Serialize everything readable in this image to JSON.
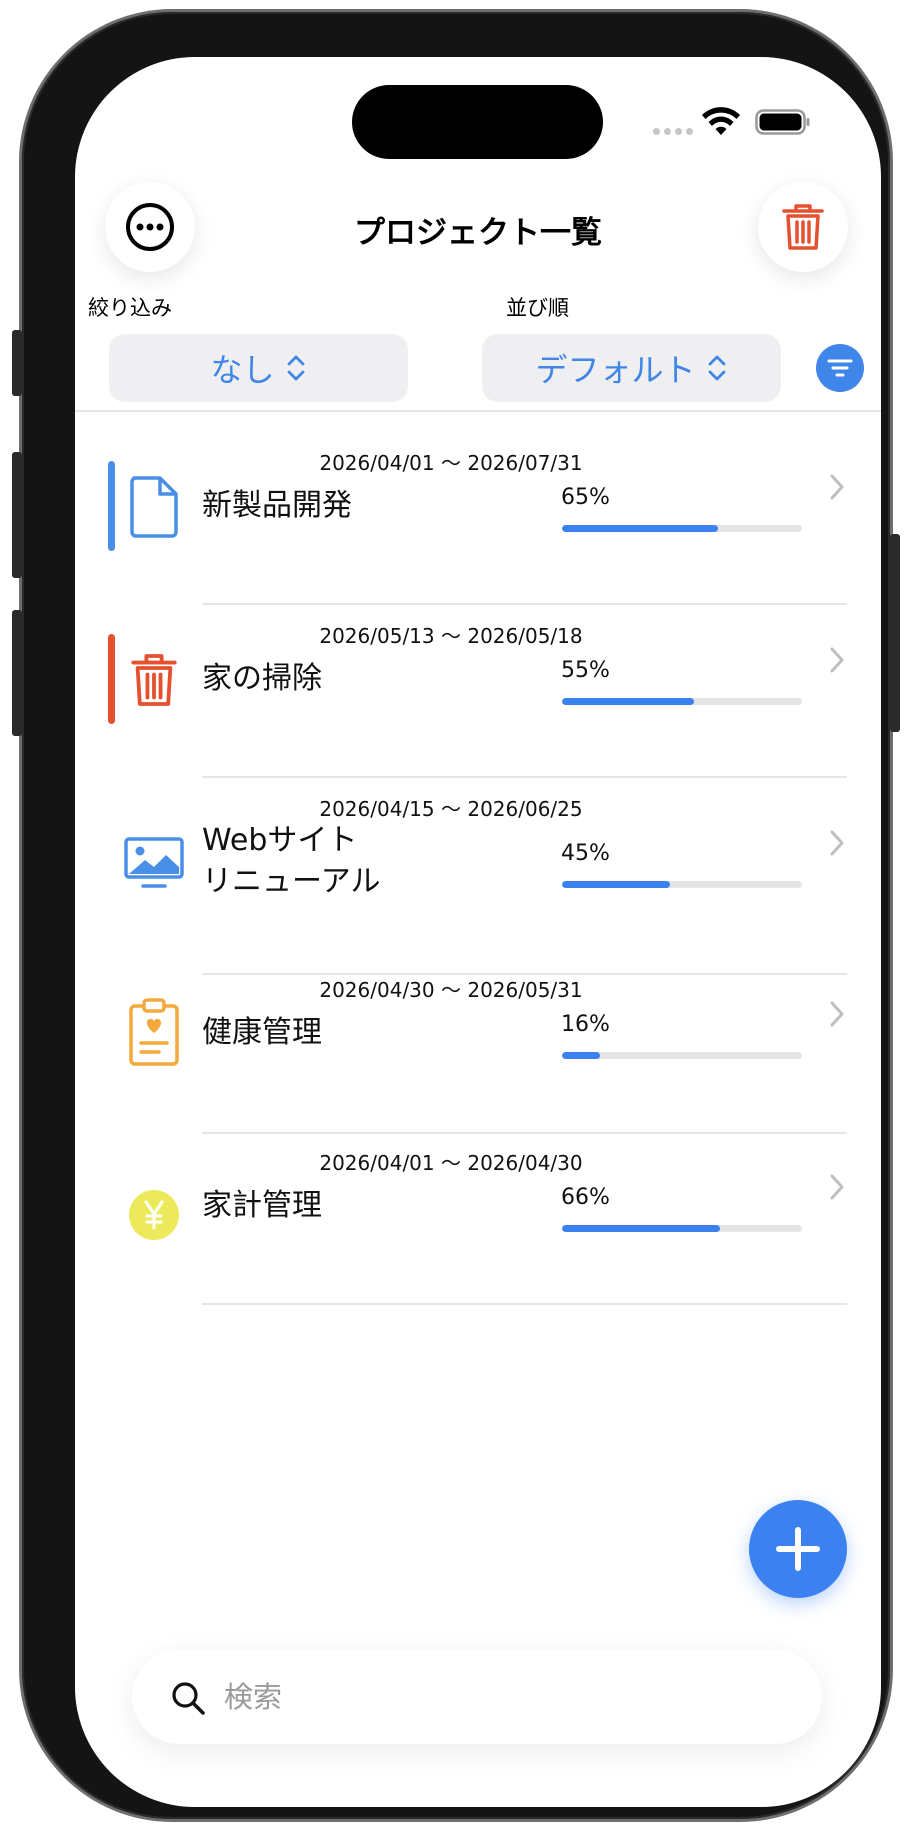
{
  "header": {
    "title": "プロジェクト一覧",
    "menu_icon": "ellipsis-circle-icon",
    "trash_icon": "trash-icon"
  },
  "filter": {
    "label": "絞り込み",
    "value": "なし"
  },
  "sort": {
    "label": "並び順",
    "value": "デフォルト"
  },
  "projects": [
    {
      "dates": "2026/04/01 〜 2026/07/31",
      "name": "新製品開発",
      "name2": "",
      "progress": 65,
      "progress_label": "65%",
      "icon": "document-icon",
      "accent": "#4a8fe7",
      "icon_color": "#4a8fe7"
    },
    {
      "dates": "2026/05/13 〜 2026/05/18",
      "name": "家の掃除",
      "name2": "",
      "progress": 55,
      "progress_label": "55%",
      "icon": "trash-icon",
      "accent": "#e5512f",
      "icon_color": "#e5512f"
    },
    {
      "dates": "2026/04/15 〜 2026/06/25",
      "name": "Webサイト",
      "name2": "リニューアル",
      "progress": 45,
      "progress_label": "45%",
      "icon": "monitor-image-icon",
      "accent": "",
      "icon_color": "#4a8fe7"
    },
    {
      "dates": "2026/04/30 〜 2026/05/31",
      "name": "健康管理",
      "name2": "",
      "progress": 16,
      "progress_label": "16%",
      "icon": "clipboard-heart-icon",
      "accent": "",
      "icon_color": "#f4a93c"
    },
    {
      "dates": "2026/04/01 〜 2026/04/30",
      "name": "家計管理",
      "name2": "",
      "progress": 66,
      "progress_label": "66%",
      "icon": "yen-circle-icon",
      "accent": "",
      "icon_color": "#ecea5a"
    }
  ],
  "search": {
    "placeholder": "検索",
    "value": ""
  },
  "colors": {
    "accent_blue": "#3b82f0",
    "trash_red": "#e5512f",
    "pill_bg": "#efeff1"
  }
}
